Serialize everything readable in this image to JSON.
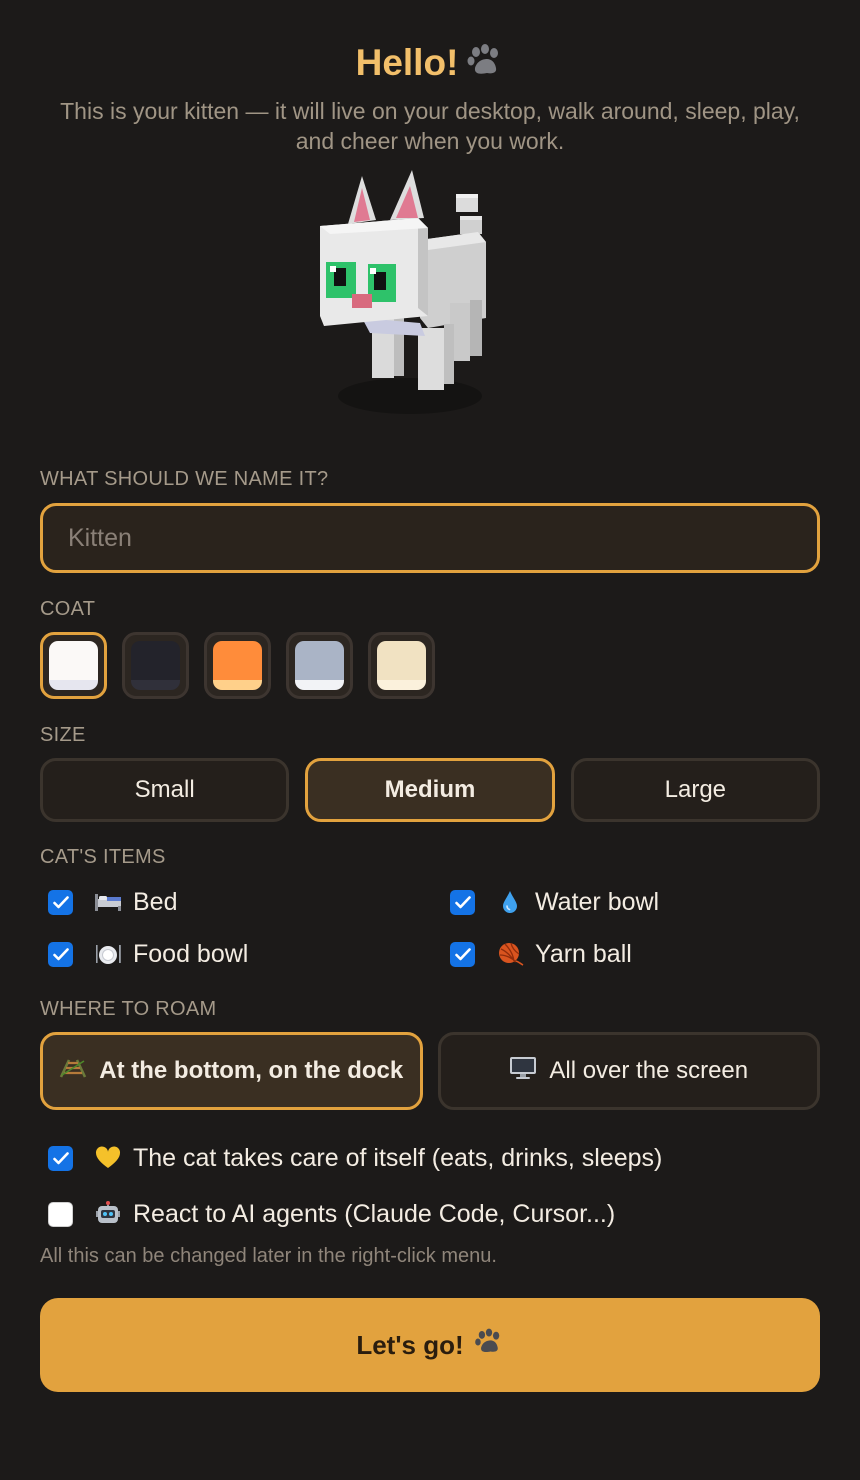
{
  "header": {
    "title": "Hello!",
    "subtitle": "This is your kitten — it will live on your desktop, walk around, sleep, play, and cheer when you work."
  },
  "name_section": {
    "label": "WHAT SHOULD WE NAME IT?",
    "placeholder": "Kitten",
    "value": ""
  },
  "coat": {
    "label": "COAT",
    "selected_index": 0,
    "options": [
      {
        "top": "#fbf9f7",
        "bottom": "#e6e6ef"
      },
      {
        "top": "#23232b",
        "bottom": "#30303a"
      },
      {
        "top": "#ff8c3a",
        "bottom": "#ffd08a"
      },
      {
        "top": "#aab4c6",
        "bottom": "#f2f3f6"
      },
      {
        "top": "#f1e2c2",
        "bottom": "#fbf1dc"
      }
    ]
  },
  "size": {
    "label": "SIZE",
    "options": [
      "Small",
      "Medium",
      "Large"
    ],
    "selected": "Medium"
  },
  "items": {
    "label": "CAT'S ITEMS",
    "list": [
      {
        "label": "Bed",
        "icon": "bed-icon",
        "checked": true
      },
      {
        "label": "Water bowl",
        "icon": "droplet-icon",
        "checked": true
      },
      {
        "label": "Food bowl",
        "icon": "plate-icon",
        "checked": true
      },
      {
        "label": "Yarn ball",
        "icon": "yarn-icon",
        "checked": true
      }
    ]
  },
  "roam": {
    "label": "WHERE TO ROAM",
    "options": [
      {
        "label": "At the bottom, on the dock",
        "icon": "railway-icon",
        "selected": true
      },
      {
        "label": "All over the screen",
        "icon": "desktop-icon",
        "selected": false
      }
    ]
  },
  "options": {
    "self_care": {
      "label": "The cat takes care of itself (eats, drinks, sleeps)",
      "icon": "yellow-heart-icon",
      "checked": true
    },
    "ai_agents": {
      "label": "React to AI agents (Claude Code, Cursor...)",
      "icon": "robot-icon",
      "checked": false
    }
  },
  "hint": "All this can be changed later in the right-click menu.",
  "submit": {
    "label": "Let's go!"
  },
  "colors": {
    "accent": "#e2a23e",
    "title": "#f2bf6a",
    "background": "#1c1a19",
    "checkbox": "#1473e6"
  }
}
